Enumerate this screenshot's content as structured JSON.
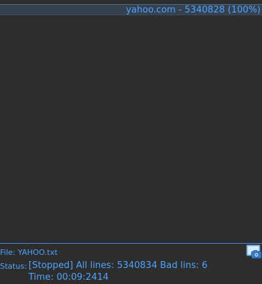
{
  "list": {
    "rows": [
      {
        "text": "yahoo.com - 5340828 (100%)"
      }
    ]
  },
  "footer": {
    "file_label": "File: YAHOO.txt",
    "status_label": "Status:",
    "status_text": "[Stopped] All lines: 5340834 Bad lins: 6",
    "time_text": "Time: 00:09:2414",
    "screenshot_icon": "camera-screenshot-icon"
  },
  "colors": {
    "background": "#2d2d2d",
    "accent": "#4fa3ff",
    "selected_row": "#36414f",
    "separator": "#4a90d9"
  }
}
